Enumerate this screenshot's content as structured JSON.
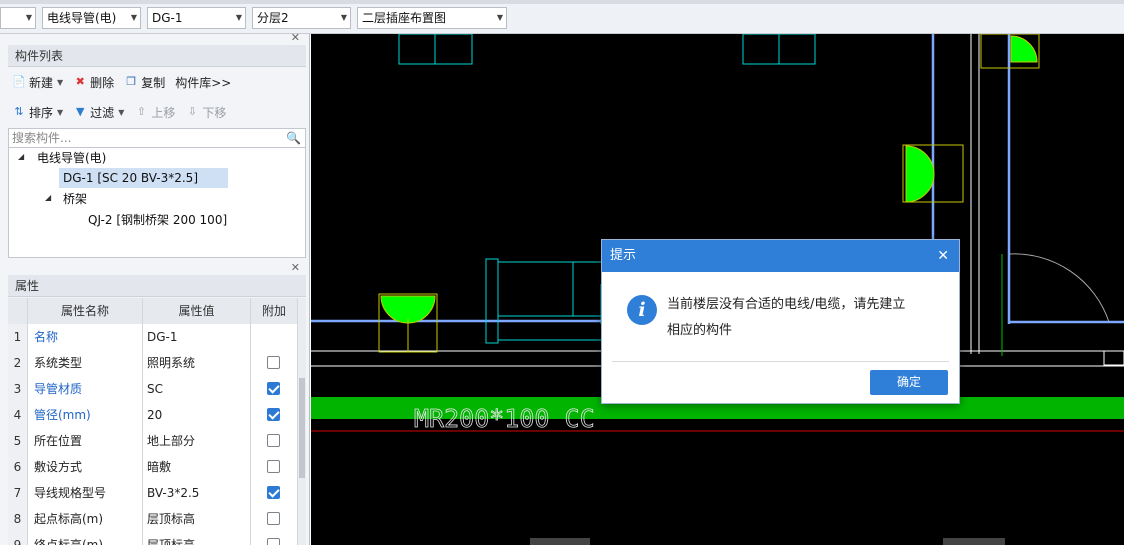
{
  "toolbar": {
    "combo0": "",
    "combo1": "电线导管(电)",
    "combo2": "DG-1",
    "combo3": "分层2",
    "combo4": "二层插座布置图"
  },
  "component_list": {
    "title": "构件列表",
    "buttons": {
      "new": "新建",
      "delete": "删除",
      "copy": "复制",
      "library": "构件库>>",
      "sort": "排序",
      "filter": "过滤",
      "move_up": "上移",
      "move_down": "下移"
    },
    "search_placeholder": "搜索构件...",
    "tree": [
      {
        "label": "电线导管(电)",
        "level": 0,
        "expanded": true
      },
      {
        "label": "DG-1 [SC 20 BV-3*2.5]",
        "level": 1,
        "selected": true
      },
      {
        "label": "桥架",
        "level": 1,
        "expanded": true
      },
      {
        "label": "QJ-2 [钢制桥架 200 100]",
        "level": 2
      }
    ]
  },
  "properties": {
    "title": "属性",
    "columns": [
      "属性名称",
      "属性值",
      "附加"
    ],
    "rows": [
      {
        "num": "1",
        "name": "名称",
        "value": "DG-1",
        "blue": true,
        "has_check": false,
        "checked": false
      },
      {
        "num": "2",
        "name": "系统类型",
        "value": "照明系统",
        "blue": false,
        "has_check": true,
        "checked": false
      },
      {
        "num": "3",
        "name": "导管材质",
        "value": "SC",
        "blue": true,
        "has_check": true,
        "checked": true
      },
      {
        "num": "4",
        "name": "管径(mm)",
        "value": "20",
        "blue": true,
        "has_check": true,
        "checked": true
      },
      {
        "num": "5",
        "name": "所在位置",
        "value": "地上部分",
        "blue": false,
        "has_check": true,
        "checked": false
      },
      {
        "num": "6",
        "name": "敷设方式",
        "value": "暗敷",
        "blue": false,
        "has_check": true,
        "checked": false
      },
      {
        "num": "7",
        "name": "导线规格型号",
        "value": "BV-3*2.5",
        "blue": false,
        "has_check": true,
        "checked": true
      },
      {
        "num": "8",
        "name": "起点标高(m)",
        "value": "层顶标高",
        "blue": false,
        "has_check": true,
        "checked": false
      },
      {
        "num": "9",
        "name": "终点标高(m)",
        "value": "层顶标高",
        "blue": false,
        "has_check": true,
        "checked": false
      }
    ]
  },
  "canvas": {
    "tray_label": "MR200*100 CC"
  },
  "dialog": {
    "title": "提示",
    "message_line1": "当前楼层没有合适的电线/电缆，请先建立",
    "message_line2": "相应的构件",
    "ok_label": "确定"
  },
  "colors": {
    "accent": "#2f7fd8",
    "tray_green": "#00b400",
    "fixture_green": "#00ff00"
  }
}
